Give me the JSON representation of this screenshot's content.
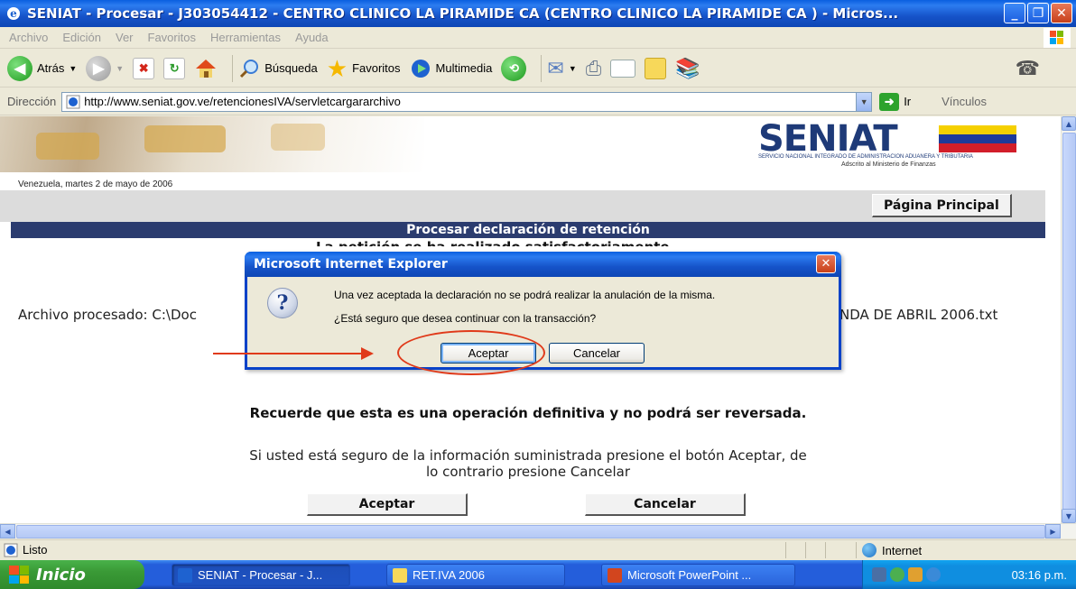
{
  "window": {
    "title": "SENIAT - Procesar - J303054412 - CENTRO CLINICO LA PIRAMIDE CA (CENTRO CLINICO LA PIRAMIDE CA ) - Micros...",
    "minimize": "_",
    "maximize": "❐",
    "close": "✕"
  },
  "menu": [
    "Archivo",
    "Edición",
    "Ver",
    "Favoritos",
    "Herramientas",
    "Ayuda"
  ],
  "toolbar": {
    "back": "Atrás",
    "search": "Búsqueda",
    "favorites": "Favoritos",
    "media": "Multimedia"
  },
  "address": {
    "label": "Dirección",
    "url": "http://www.seniat.gov.ve/retencionesIVA/servletcargararchivo",
    "go": "Ir",
    "links": "Vínculos"
  },
  "page": {
    "logo_text": "SENIAT",
    "logo_sub1": "SERVICIO NACIONAL INTEGRADO DE ADMINISTRACION ADUANERA Y TRIBUTARIA",
    "logo_sub2": "Adscrito al Ministerio de Finanzas",
    "date": "Venezuela, martes 2 de mayo de 2006",
    "home_button": "Página Principal",
    "header": "Procesar declaración de retención",
    "hidden_title": "La petición se ha realizado satisfactoriamente",
    "archivo_start": "Archivo procesado: C:\\Doc",
    "archivo_end": "NDA DE ABRIL 2006.txt",
    "recuerde": "Recuerde que esta es una operación definitiva y no podrá ser reversada.",
    "si_usted": "Si usted está seguro de la información suministrada presione el botón Aceptar, de lo contrario presione Cancelar",
    "accept": "Aceptar",
    "cancel": "Cancelar"
  },
  "dialog": {
    "title": "Microsoft Internet Explorer",
    "message1": "Una vez aceptada la declaración no se podrá realizar la anulación de la misma.",
    "message2": "¿Está seguro que desea continuar con la transacción?",
    "accept": "Aceptar",
    "cancel": "Cancelar",
    "icon": "question-icon"
  },
  "status": {
    "text": "Listo",
    "zone": "Internet"
  },
  "taskbar": {
    "start": "Inicio",
    "tasks": [
      "SENIAT - Procesar - J...",
      "RET.IVA 2006",
      "Microsoft PowerPoint ..."
    ],
    "clock": "03:16 p.m."
  },
  "colors": {
    "header_bar": "#2B3C6F",
    "annotation": "#E03A1A",
    "xp_blue": "#245EDB"
  }
}
